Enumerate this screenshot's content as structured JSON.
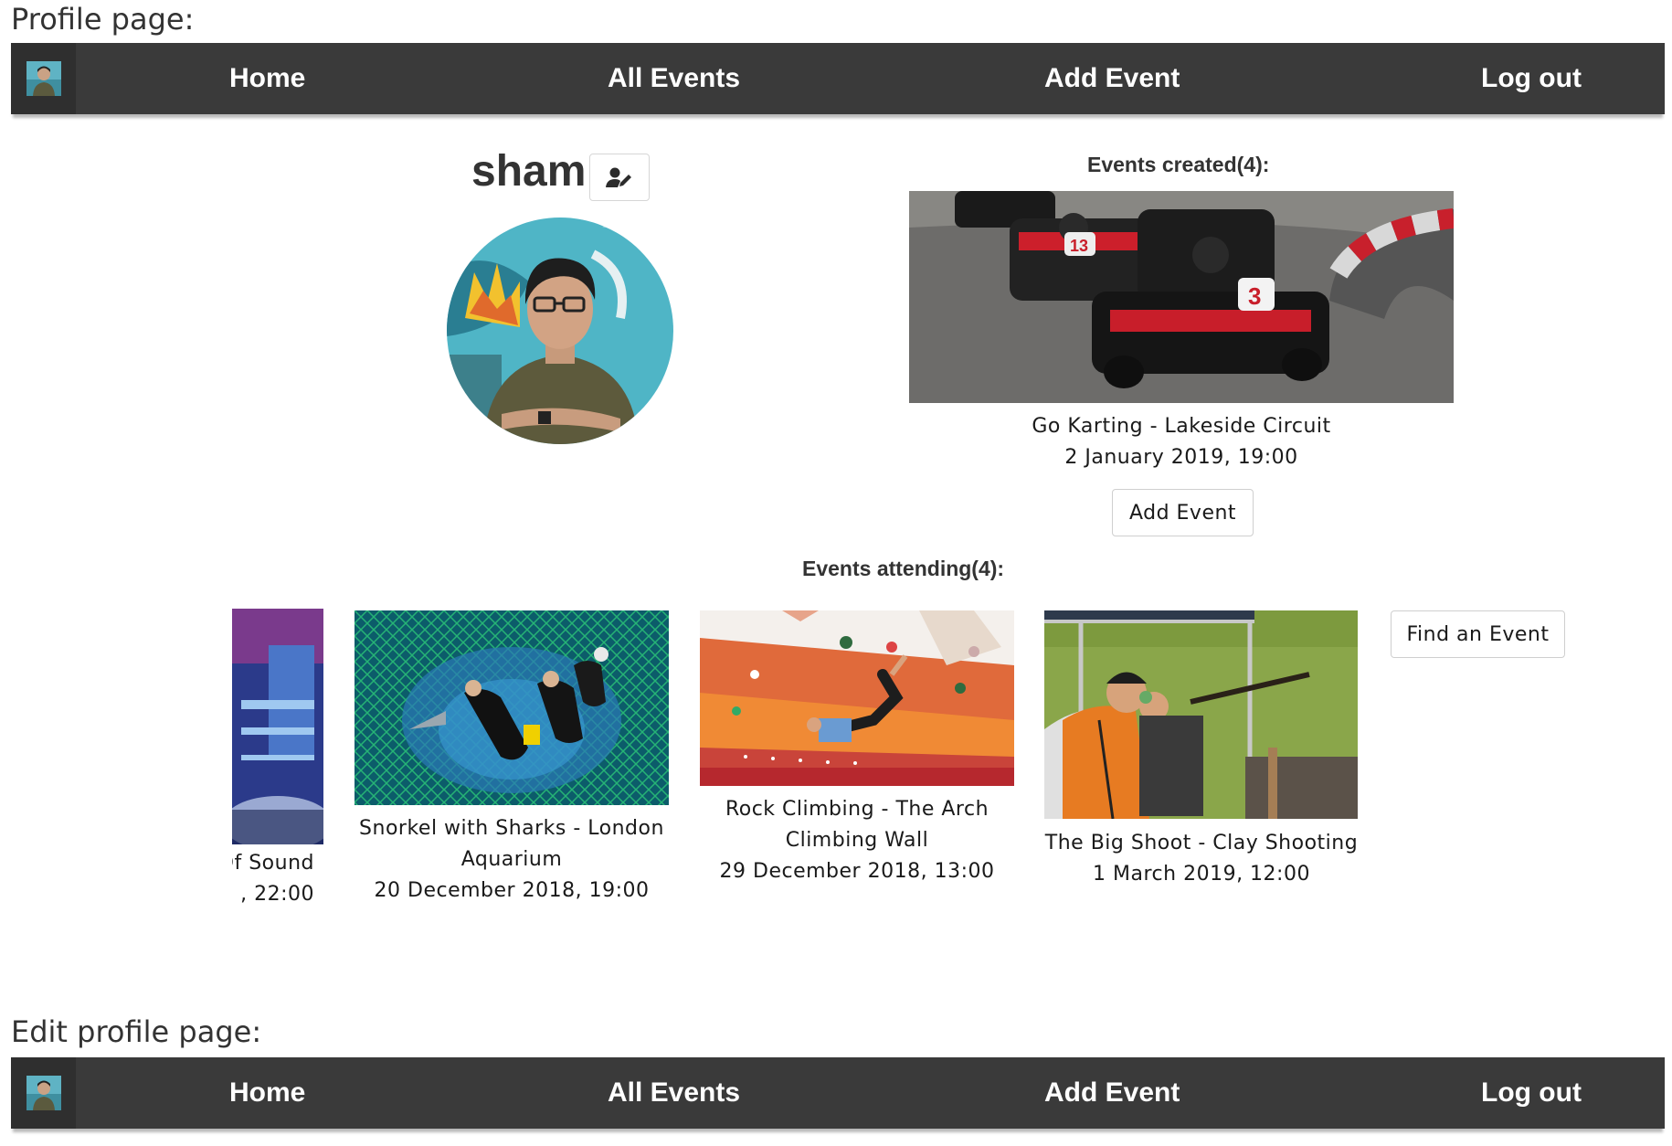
{
  "sections": {
    "profile_title": "Profile page:",
    "edit_title": "Edit profile page:"
  },
  "navbar": {
    "links": [
      "Home",
      "All Events",
      "Add Event",
      "Log out"
    ]
  },
  "profile": {
    "username": "sham",
    "edit_icon": "user-edit-icon"
  },
  "created": {
    "heading": "Events created(4):",
    "event": {
      "title": "Go Karting - Lakeside Circuit",
      "date": "2 January 2019, 19:00"
    },
    "add_button": "Add Event"
  },
  "attending": {
    "heading": "Events attending(4):",
    "partial_event": {
      "title_fragment": "Of Sound",
      "date_fragment": ", 22:00"
    },
    "events": [
      {
        "title_line1": "Snorkel with Sharks - London",
        "title_line2": "Aquarium",
        "date": "20 December 2018, 19:00"
      },
      {
        "title_line1": "Rock Climbing - The Arch",
        "title_line2": "Climbing Wall",
        "date": "29 December 2018, 13:00"
      },
      {
        "title_line1": "The Big Shoot - Clay Shooting",
        "date": "1 March 2019, 12:00"
      }
    ],
    "find_button": "Find an Event"
  },
  "colors": {
    "navbar": "#3a3a3a",
    "navbar_avatar_bg": "#2f2f2f",
    "nav_text": "#ffffff"
  }
}
